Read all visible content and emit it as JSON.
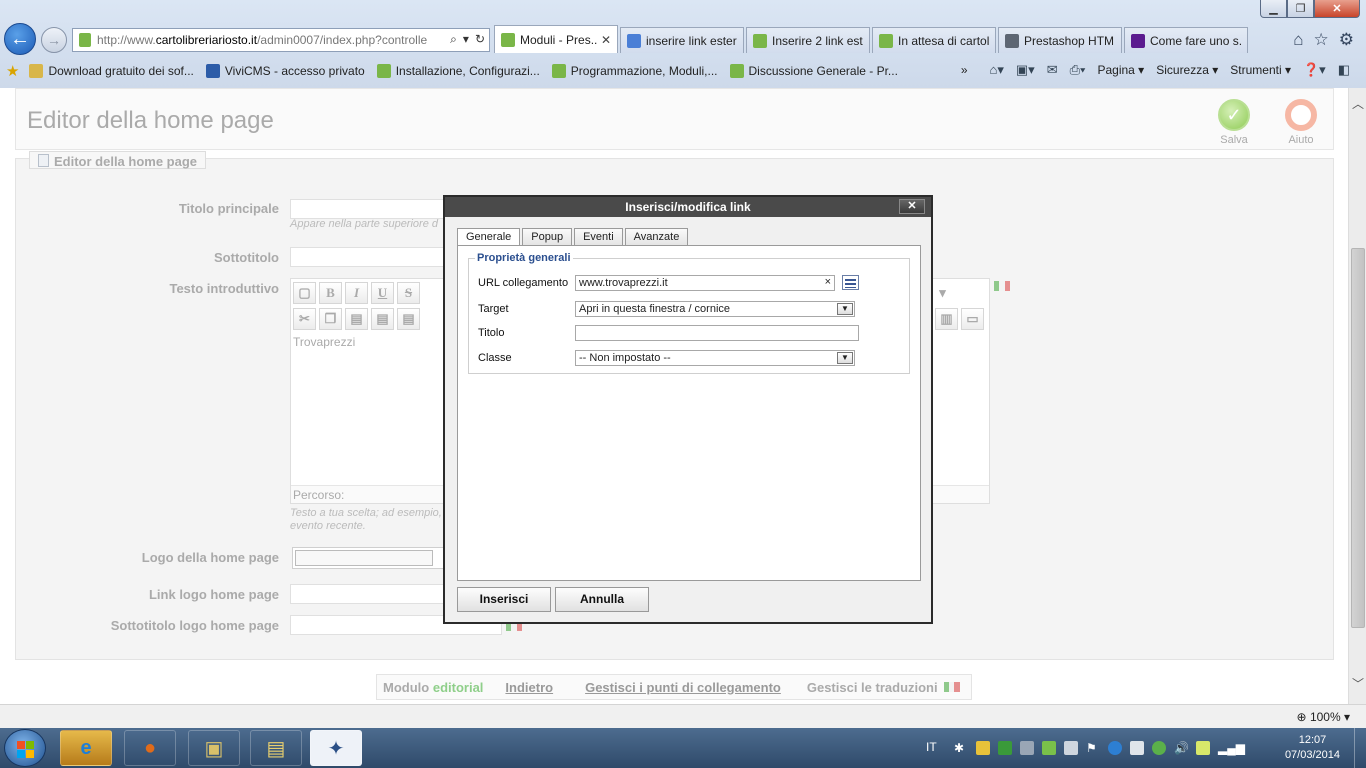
{
  "browser": {
    "address": {
      "prefix": "http://www.",
      "host": "cartolibreriariosto.it",
      "rest": "/admin0007/index.php?controlle"
    },
    "tabs": [
      {
        "label": "Moduli - Pres...",
        "active": true,
        "favicon_color": "#7ab648"
      },
      {
        "label": "inserire link ester...",
        "active": false,
        "favicon_color": "#4a7fd6"
      },
      {
        "label": "Inserire 2 link est...",
        "active": false,
        "favicon_color": "#7ab648"
      },
      {
        "label": "In attesa di cartol...",
        "active": false,
        "favicon_color": "#7ab648"
      },
      {
        "label": "Prestashop HTM...",
        "active": false,
        "favicon_color": "#5d6673"
      },
      {
        "label": "Come fare uno s...",
        "active": false,
        "favicon_color": "#5b1b8f"
      }
    ],
    "favorites": [
      {
        "label": "Download gratuito dei sof...",
        "icon_color": "#d8b64a"
      },
      {
        "label": "ViviCMS - accesso privato",
        "icon_color": "#2c5ca8"
      },
      {
        "label": "Installazione, Configurazi...",
        "icon_color": "#7ab648"
      },
      {
        "label": "Programmazione, Moduli,...",
        "icon_color": "#7ab648"
      },
      {
        "label": "Discussione Generale - Pr...",
        "icon_color": "#7ab648"
      }
    ],
    "command_bar": {
      "more": "»",
      "page": "Pagina ▾",
      "security": "Sicurezza ▾",
      "tools": "Strumenti ▾"
    },
    "zoom": "100%"
  },
  "page": {
    "title": "Editor della home page",
    "save_label": "Salva",
    "help_label": "Aiuto",
    "fieldset_legend": "Editor della home page",
    "labels": {
      "main_title": "Titolo principale",
      "subtitle": "Sottotitolo",
      "intro_text": "Testo introduttivo",
      "logo": "Logo della home page",
      "logo_link": "Link logo home page",
      "logo_subtitle": "Sottotitolo logo home page"
    },
    "hints": {
      "main_title": "Appare nella parte superiore d",
      "intro_line1": "Testo a tua scelta; ad esempio,",
      "intro_line2": "evento recente."
    },
    "editor": {
      "content": "Trovaprezzi",
      "path": "Percorso:"
    },
    "footer": {
      "module_prefix": "Modulo",
      "module_name": "editorial",
      "back": "Indietro",
      "hooks": "Gestisci i punti di collegamento",
      "translations": "Gestisci le traduzioni"
    }
  },
  "dialog": {
    "title": "Inserisci/modifica link",
    "tabs": [
      "Generale",
      "Popup",
      "Eventi",
      "Avanzate"
    ],
    "active_tab": "Generale",
    "group_legend": "Proprietà generali",
    "fields": {
      "url_label": "URL collegamento",
      "url_value": "www.trovaprezzi.it",
      "target_label": "Target",
      "target_value": "Apri in questa finestra / cornice",
      "title_label": "Titolo",
      "title_value": "",
      "class_label": "Classe",
      "class_value": "-- Non impostato --"
    },
    "insert_label": "Inserisci",
    "cancel_label": "Annulla"
  },
  "taskbar": {
    "lang": "IT",
    "time": "12:07",
    "date": "07/03/2014"
  }
}
